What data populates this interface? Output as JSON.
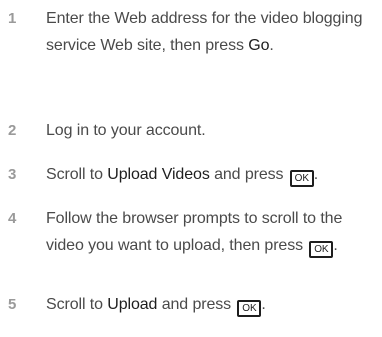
{
  "steps": [
    {
      "number": "1",
      "text_a": "Enter the Web address for the video blogging service Web site, then press ",
      "em_a": "Go",
      "text_b": "."
    },
    {
      "number": "2",
      "text_a": "Log in to your account."
    },
    {
      "number": "3",
      "text_a": "Scroll to ",
      "em_a": "Upload Videos",
      "text_b": " and press ",
      "key": "OK",
      "text_c": "."
    },
    {
      "number": "4",
      "text_a": "Follow the browser prompts to scroll to the video you want to upload, then press ",
      "key": "OK",
      "text_c": "."
    },
    {
      "number": "5",
      "text_a": "Scroll to ",
      "em_a": "Upload",
      "text_b": " and press ",
      "key": "OK",
      "text_c": "."
    }
  ]
}
